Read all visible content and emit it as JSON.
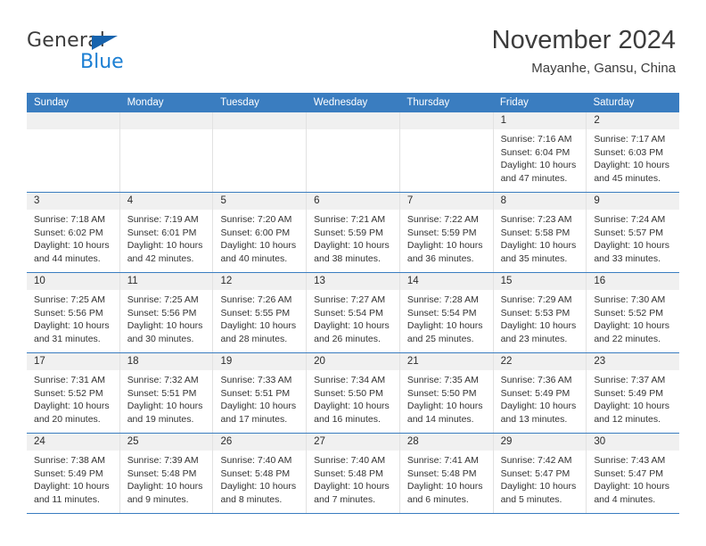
{
  "brand": {
    "name_part1": "General",
    "name_part2": "Blue",
    "triangle_color": "#1763ad",
    "blue_color": "#1c7fd3"
  },
  "header": {
    "title": "November 2024",
    "subtitle": "Mayanhe, Gansu, China"
  },
  "theme": {
    "header_row_bg": "#3a7dc0",
    "header_row_text": "#ffffff",
    "daynum_bg": "#f0f0f0",
    "row_separator": "#3a7dc0",
    "cell_separator": "#e2e2e2"
  },
  "weekdays": [
    "Sunday",
    "Monday",
    "Tuesday",
    "Wednesday",
    "Thursday",
    "Friday",
    "Saturday"
  ],
  "weeks": [
    [
      {
        "day": "",
        "empty": true
      },
      {
        "day": "",
        "empty": true
      },
      {
        "day": "",
        "empty": true
      },
      {
        "day": "",
        "empty": true
      },
      {
        "day": "",
        "empty": true
      },
      {
        "day": "1",
        "sunrise": "Sunrise: 7:16 AM",
        "sunset": "Sunset: 6:04 PM",
        "daylight": "Daylight: 10 hours and 47 minutes."
      },
      {
        "day": "2",
        "sunrise": "Sunrise: 7:17 AM",
        "sunset": "Sunset: 6:03 PM",
        "daylight": "Daylight: 10 hours and 45 minutes."
      }
    ],
    [
      {
        "day": "3",
        "sunrise": "Sunrise: 7:18 AM",
        "sunset": "Sunset: 6:02 PM",
        "daylight": "Daylight: 10 hours and 44 minutes."
      },
      {
        "day": "4",
        "sunrise": "Sunrise: 7:19 AM",
        "sunset": "Sunset: 6:01 PM",
        "daylight": "Daylight: 10 hours and 42 minutes."
      },
      {
        "day": "5",
        "sunrise": "Sunrise: 7:20 AM",
        "sunset": "Sunset: 6:00 PM",
        "daylight": "Daylight: 10 hours and 40 minutes."
      },
      {
        "day": "6",
        "sunrise": "Sunrise: 7:21 AM",
        "sunset": "Sunset: 5:59 PM",
        "daylight": "Daylight: 10 hours and 38 minutes."
      },
      {
        "day": "7",
        "sunrise": "Sunrise: 7:22 AM",
        "sunset": "Sunset: 5:59 PM",
        "daylight": "Daylight: 10 hours and 36 minutes."
      },
      {
        "day": "8",
        "sunrise": "Sunrise: 7:23 AM",
        "sunset": "Sunset: 5:58 PM",
        "daylight": "Daylight: 10 hours and 35 minutes."
      },
      {
        "day": "9",
        "sunrise": "Sunrise: 7:24 AM",
        "sunset": "Sunset: 5:57 PM",
        "daylight": "Daylight: 10 hours and 33 minutes."
      }
    ],
    [
      {
        "day": "10",
        "sunrise": "Sunrise: 7:25 AM",
        "sunset": "Sunset: 5:56 PM",
        "daylight": "Daylight: 10 hours and 31 minutes."
      },
      {
        "day": "11",
        "sunrise": "Sunrise: 7:25 AM",
        "sunset": "Sunset: 5:56 PM",
        "daylight": "Daylight: 10 hours and 30 minutes."
      },
      {
        "day": "12",
        "sunrise": "Sunrise: 7:26 AM",
        "sunset": "Sunset: 5:55 PM",
        "daylight": "Daylight: 10 hours and 28 minutes."
      },
      {
        "day": "13",
        "sunrise": "Sunrise: 7:27 AM",
        "sunset": "Sunset: 5:54 PM",
        "daylight": "Daylight: 10 hours and 26 minutes."
      },
      {
        "day": "14",
        "sunrise": "Sunrise: 7:28 AM",
        "sunset": "Sunset: 5:54 PM",
        "daylight": "Daylight: 10 hours and 25 minutes."
      },
      {
        "day": "15",
        "sunrise": "Sunrise: 7:29 AM",
        "sunset": "Sunset: 5:53 PM",
        "daylight": "Daylight: 10 hours and 23 minutes."
      },
      {
        "day": "16",
        "sunrise": "Sunrise: 7:30 AM",
        "sunset": "Sunset: 5:52 PM",
        "daylight": "Daylight: 10 hours and 22 minutes."
      }
    ],
    [
      {
        "day": "17",
        "sunrise": "Sunrise: 7:31 AM",
        "sunset": "Sunset: 5:52 PM",
        "daylight": "Daylight: 10 hours and 20 minutes."
      },
      {
        "day": "18",
        "sunrise": "Sunrise: 7:32 AM",
        "sunset": "Sunset: 5:51 PM",
        "daylight": "Daylight: 10 hours and 19 minutes."
      },
      {
        "day": "19",
        "sunrise": "Sunrise: 7:33 AM",
        "sunset": "Sunset: 5:51 PM",
        "daylight": "Daylight: 10 hours and 17 minutes."
      },
      {
        "day": "20",
        "sunrise": "Sunrise: 7:34 AM",
        "sunset": "Sunset: 5:50 PM",
        "daylight": "Daylight: 10 hours and 16 minutes."
      },
      {
        "day": "21",
        "sunrise": "Sunrise: 7:35 AM",
        "sunset": "Sunset: 5:50 PM",
        "daylight": "Daylight: 10 hours and 14 minutes."
      },
      {
        "day": "22",
        "sunrise": "Sunrise: 7:36 AM",
        "sunset": "Sunset: 5:49 PM",
        "daylight": "Daylight: 10 hours and 13 minutes."
      },
      {
        "day": "23",
        "sunrise": "Sunrise: 7:37 AM",
        "sunset": "Sunset: 5:49 PM",
        "daylight": "Daylight: 10 hours and 12 minutes."
      }
    ],
    [
      {
        "day": "24",
        "sunrise": "Sunrise: 7:38 AM",
        "sunset": "Sunset: 5:49 PM",
        "daylight": "Daylight: 10 hours and 11 minutes."
      },
      {
        "day": "25",
        "sunrise": "Sunrise: 7:39 AM",
        "sunset": "Sunset: 5:48 PM",
        "daylight": "Daylight: 10 hours and 9 minutes."
      },
      {
        "day": "26",
        "sunrise": "Sunrise: 7:40 AM",
        "sunset": "Sunset: 5:48 PM",
        "daylight": "Daylight: 10 hours and 8 minutes."
      },
      {
        "day": "27",
        "sunrise": "Sunrise: 7:40 AM",
        "sunset": "Sunset: 5:48 PM",
        "daylight": "Daylight: 10 hours and 7 minutes."
      },
      {
        "day": "28",
        "sunrise": "Sunrise: 7:41 AM",
        "sunset": "Sunset: 5:48 PM",
        "daylight": "Daylight: 10 hours and 6 minutes."
      },
      {
        "day": "29",
        "sunrise": "Sunrise: 7:42 AM",
        "sunset": "Sunset: 5:47 PM",
        "daylight": "Daylight: 10 hours and 5 minutes."
      },
      {
        "day": "30",
        "sunrise": "Sunrise: 7:43 AM",
        "sunset": "Sunset: 5:47 PM",
        "daylight": "Daylight: 10 hours and 4 minutes."
      }
    ]
  ]
}
